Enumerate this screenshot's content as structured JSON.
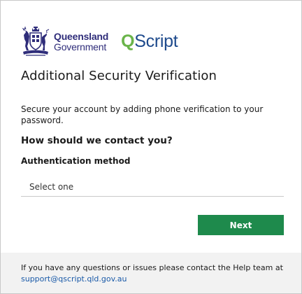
{
  "branding": {
    "government_line1": "Queensland",
    "government_line2": "Government",
    "product_q": "Q",
    "product_rest": "Script",
    "government_color": "#2f2d7a",
    "product_q_color": "#6ab44a",
    "product_rest_color": "#1e4a8c",
    "crest_icon": "queensland-coat-of-arms-icon"
  },
  "page": {
    "title": "Additional Security Verification",
    "intro": "Secure your account by adding phone verification to your password.",
    "question": "How should we contact you?"
  },
  "form": {
    "auth_method_label": "Authentication method",
    "auth_method_value": "Select one",
    "next_label": "Next",
    "next_color": "#1e8a4c"
  },
  "footer": {
    "help_text": "If you have any questions or issues please contact the Help team at",
    "support_email": "support@qscript.qld.gov.au",
    "link_color": "#1a5aa8",
    "background": "#f2f2f2"
  }
}
